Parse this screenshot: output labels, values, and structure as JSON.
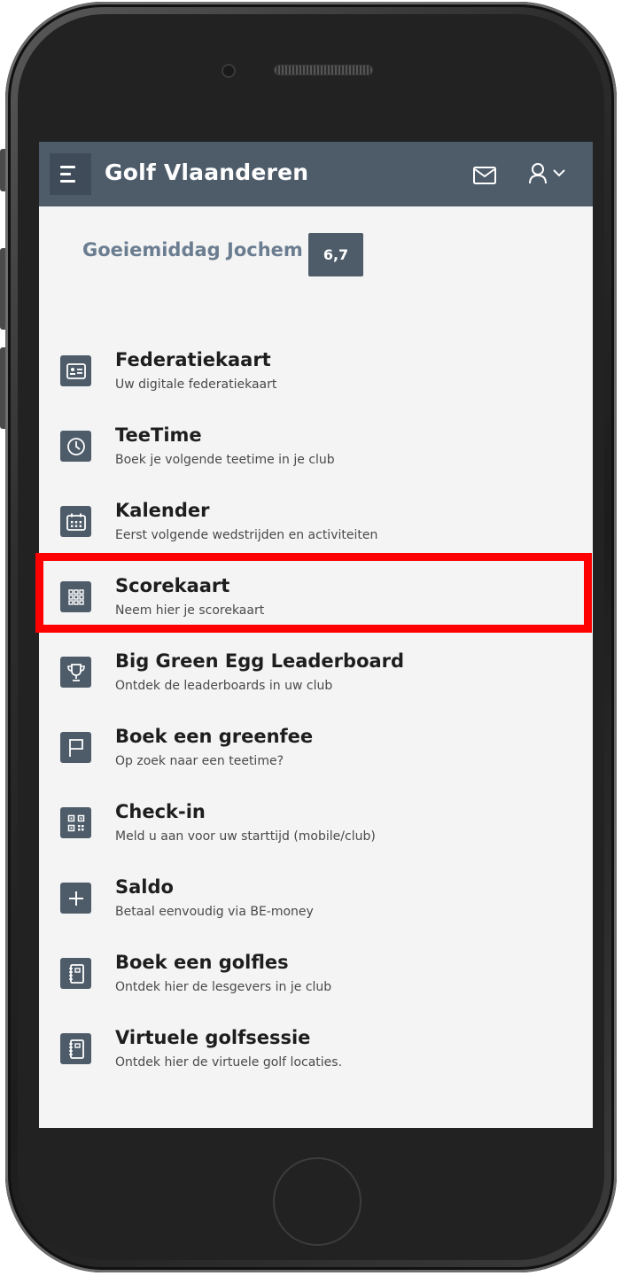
{
  "app": {
    "title": "Golf Vlaanderen"
  },
  "greeting": {
    "text": "Goeiemiddag Jochem",
    "handicap": "6,7"
  },
  "menu": [
    {
      "icon": "id-card-icon",
      "title": "Federatiekaart",
      "subtitle": "Uw digitale federatiekaart"
    },
    {
      "icon": "clock-icon",
      "title": "TeeTime",
      "subtitle": "Boek je volgende teetime in je club"
    },
    {
      "icon": "calendar-icon",
      "title": "Kalender",
      "subtitle": "Eerst volgende wedstrijden en activiteiten"
    },
    {
      "icon": "grid-icon",
      "title": "Scorekaart",
      "subtitle": "Neem hier je scorekaart"
    },
    {
      "icon": "trophy-icon",
      "title": "Big Green Egg Leaderboard",
      "subtitle": "Ontdek de leaderboards in uw club"
    },
    {
      "icon": "flag-icon",
      "title": "Boek een greenfee",
      "subtitle": "Op zoek naar een teetime?"
    },
    {
      "icon": "qr-code-icon",
      "title": "Check-in",
      "subtitle": "Meld u aan voor uw starttijd (mobile/club)"
    },
    {
      "icon": "plus-icon",
      "title": "Saldo",
      "subtitle": "Betaal eenvoudig via BE-money"
    },
    {
      "icon": "notebook-icon",
      "title": "Boek een golfles",
      "subtitle": "Ontdek hier de lesgevers in je club"
    },
    {
      "icon": "notebook-icon",
      "title": "Virtuele golfsessie",
      "subtitle": "Ontdek hier de virtuele golf locaties."
    }
  ],
  "colors": {
    "header": "#4e5c6a",
    "background": "#f4f4f4",
    "greeting": "#6b7d90",
    "highlight": "#ff0000"
  }
}
